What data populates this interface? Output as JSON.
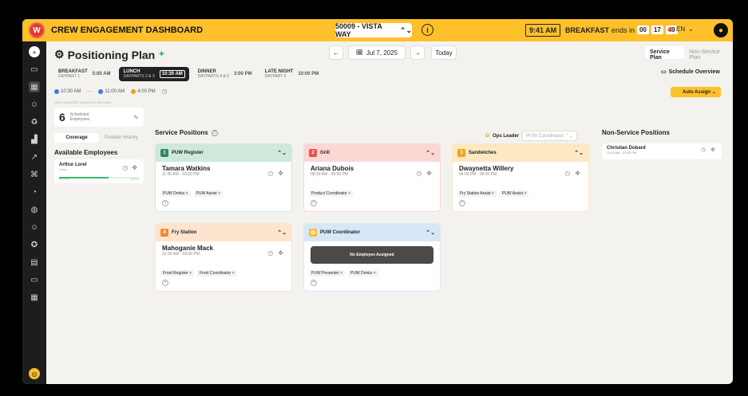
{
  "app": {
    "title": "CREW ENGAGEMENT DASHBOARD",
    "logo": "W"
  },
  "topbar": {
    "store": "50009 - VISTA WAY",
    "store_chevron": "⌃⌄",
    "info": "i",
    "clock": "9:41 AM",
    "meal_name": "BREAKFAST",
    "ends_in": "ends in",
    "timer": [
      "00",
      "17",
      "49"
    ],
    "language": "EN",
    "lang_chevron": "⌄",
    "accent_color": "#ffc02a"
  },
  "sidebar": {
    "icons": [
      "expand-icon",
      "monitor-icon",
      "calendar-icon",
      "people-icon",
      "recycle-icon",
      "chart-icon",
      "trend-icon",
      "puzzle-icon",
      "timer-icon",
      "cup-icon",
      "smile-icon",
      "medal-icon",
      "clipboard-icon",
      "list-icon",
      "grid-icon"
    ],
    "glyphs": [
      "»",
      "▭",
      "▦",
      "☺",
      "♻",
      "▟",
      "↗",
      "⌘",
      "◔",
      "◍",
      "☺",
      "✪",
      "▤",
      "▭",
      "▦"
    ],
    "bottom_icon": "globe-icon",
    "bottom_glyph": "◎"
  },
  "header": {
    "title": "Positioning Plan",
    "title_icon": "⚙",
    "title_sparkle": "✦",
    "prev": "←",
    "next": "→",
    "calendar_icon": "🗓",
    "date": "Jul 7, 2025",
    "today": "Today",
    "service_plan": "Service Plan",
    "non_service_plan": "Non-Service Plan",
    "schedule_overview": "Schedule Overview",
    "schedule_icon": "▭"
  },
  "meals": [
    {
      "name": "BREAKFAST",
      "sub": "DAYPART 1",
      "time": "5:00 AM",
      "active": false
    },
    {
      "name": "LUNCH",
      "sub": "DAYPARTS 2 & 3",
      "time": "10:30 AM",
      "active": true
    },
    {
      "name": "DINNER",
      "sub": "DAYPARTS 4 & 5",
      "time": "3:00 PM",
      "active": false
    },
    {
      "name": "LATE NIGHT",
      "sub": "DAYPART 6",
      "time": "10:00 PM",
      "active": false
    }
  ],
  "times": [
    {
      "label": "10:30 AM",
      "color": "#3b7ddd"
    },
    {
      "label": "11:00 AM",
      "color": "#3b7ddd"
    },
    {
      "label": "4:00 PM",
      "color": "#e8a400"
    }
  ],
  "time_sep": "—",
  "time_icon": "◷",
  "auto_assign": "Auto Assign",
  "auto_icon": "⚡",
  "auto_chevron": "⌄",
  "left": {
    "last_updated": "LAST UPDATED: 2025-07-07 09:41 AM",
    "scheduled_count": "6",
    "scheduled_label": "Scheduled Employees",
    "edit_icon": "✎",
    "tab_coverage": "Coverage",
    "tab_history": "Position History",
    "available_heading": "Available Employees",
    "employee": {
      "name": "Arthur Lorel",
      "sub": "Crew",
      "start": "10:00 AM",
      "end": "3:00 PM",
      "bar_fraction": 0.62,
      "clock_icon": "◷",
      "move_icon": "✥"
    }
  },
  "service": {
    "title": "Service Positions",
    "help": "?",
    "ops_leader": "Ops Leader",
    "ops_select": "PUW Coordinator",
    "ops_icon": "✪",
    "select_chevron": "⌃⌄",
    "chevron": "⌃⌄",
    "clock_icon": "◷",
    "move_icon": "✥",
    "remove": "×",
    "add": "+",
    "positions": [
      {
        "num": "1",
        "name": "PUW Register",
        "employee": "Tamara Watkins",
        "time": "11:00 AM - 03:00 PM",
        "tags": [
          "PUW Drinks",
          "PUW Assist"
        ],
        "head_bg": "#cfe8dc",
        "num_bg": "#2f8a5e",
        "border": "#cfe8dc"
      },
      {
        "num": "2",
        "name": "Grill",
        "employee": "Ariana Dubois",
        "time": "08:30 AM - 05:00 PM",
        "tags": [
          "Product Coordinator"
        ],
        "head_bg": "#fbd7d3",
        "num_bg": "#e2554a",
        "border": "#fbd7d3"
      },
      {
        "num": "3",
        "name": "Sandwiches",
        "employee": "Dwaynetta Willery",
        "time": "04:00 PM - 09:00 PM",
        "tags": [
          "Fry Station Assist",
          "PUW Assist"
        ],
        "head_bg": "#fde8c4",
        "num_bg": "#f3a41b",
        "border": "#fde8c4"
      },
      {
        "num": "4",
        "name": "Fry Station",
        "employee": "Mahoganie Mack",
        "time": "10:30 AM - 03:00 PM",
        "tags": [
          "Front Register",
          "Front Coordinator"
        ],
        "head_bg": "#fde4cf",
        "num_bg": "#f08a32",
        "border": "#fde4cf"
      },
      {
        "num": "✪",
        "name": "PUW Coordinator",
        "employee": "",
        "time": "",
        "no_employee": "No Employee Assigned",
        "tags": [
          "PUW Presenter",
          "PUW Drinks"
        ],
        "head_bg": "#d6e8f8",
        "num_bg": "#ffc02a",
        "border": "#d6e8f8"
      }
    ]
  },
  "non_service": {
    "title": "Non-Service Positions",
    "employee": "Christian Dobard",
    "time": "11:00 AM - 03:00 PM",
    "clock_icon": "◷",
    "move_icon": "✥"
  }
}
